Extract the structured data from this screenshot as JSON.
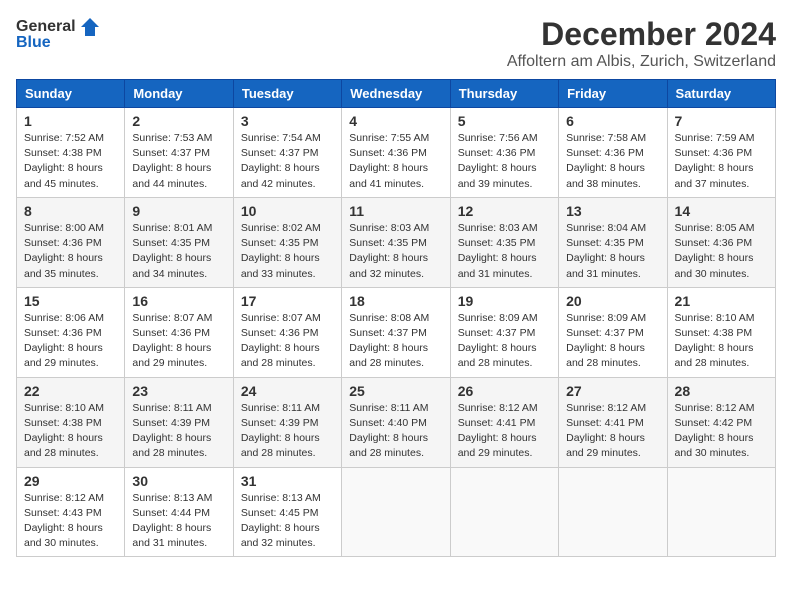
{
  "logo": {
    "line1": "General",
    "line2": "Blue"
  },
  "title": "December 2024",
  "location": "Affoltern am Albis, Zurich, Switzerland",
  "days_of_week": [
    "Sunday",
    "Monday",
    "Tuesday",
    "Wednesday",
    "Thursday",
    "Friday",
    "Saturday"
  ],
  "weeks": [
    [
      {
        "day": "1",
        "sunrise": "7:52 AM",
        "sunset": "4:38 PM",
        "daylight": "8 hours and 45 minutes."
      },
      {
        "day": "2",
        "sunrise": "7:53 AM",
        "sunset": "4:37 PM",
        "daylight": "8 hours and 44 minutes."
      },
      {
        "day": "3",
        "sunrise": "7:54 AM",
        "sunset": "4:37 PM",
        "daylight": "8 hours and 42 minutes."
      },
      {
        "day": "4",
        "sunrise": "7:55 AM",
        "sunset": "4:36 PM",
        "daylight": "8 hours and 41 minutes."
      },
      {
        "day": "5",
        "sunrise": "7:56 AM",
        "sunset": "4:36 PM",
        "daylight": "8 hours and 39 minutes."
      },
      {
        "day": "6",
        "sunrise": "7:58 AM",
        "sunset": "4:36 PM",
        "daylight": "8 hours and 38 minutes."
      },
      {
        "day": "7",
        "sunrise": "7:59 AM",
        "sunset": "4:36 PM",
        "daylight": "8 hours and 37 minutes."
      }
    ],
    [
      {
        "day": "8",
        "sunrise": "8:00 AM",
        "sunset": "4:36 PM",
        "daylight": "8 hours and 35 minutes."
      },
      {
        "day": "9",
        "sunrise": "8:01 AM",
        "sunset": "4:35 PM",
        "daylight": "8 hours and 34 minutes."
      },
      {
        "day": "10",
        "sunrise": "8:02 AM",
        "sunset": "4:35 PM",
        "daylight": "8 hours and 33 minutes."
      },
      {
        "day": "11",
        "sunrise": "8:03 AM",
        "sunset": "4:35 PM",
        "daylight": "8 hours and 32 minutes."
      },
      {
        "day": "12",
        "sunrise": "8:03 AM",
        "sunset": "4:35 PM",
        "daylight": "8 hours and 31 minutes."
      },
      {
        "day": "13",
        "sunrise": "8:04 AM",
        "sunset": "4:35 PM",
        "daylight": "8 hours and 31 minutes."
      },
      {
        "day": "14",
        "sunrise": "8:05 AM",
        "sunset": "4:36 PM",
        "daylight": "8 hours and 30 minutes."
      }
    ],
    [
      {
        "day": "15",
        "sunrise": "8:06 AM",
        "sunset": "4:36 PM",
        "daylight": "8 hours and 29 minutes."
      },
      {
        "day": "16",
        "sunrise": "8:07 AM",
        "sunset": "4:36 PM",
        "daylight": "8 hours and 29 minutes."
      },
      {
        "day": "17",
        "sunrise": "8:07 AM",
        "sunset": "4:36 PM",
        "daylight": "8 hours and 28 minutes."
      },
      {
        "day": "18",
        "sunrise": "8:08 AM",
        "sunset": "4:37 PM",
        "daylight": "8 hours and 28 minutes."
      },
      {
        "day": "19",
        "sunrise": "8:09 AM",
        "sunset": "4:37 PM",
        "daylight": "8 hours and 28 minutes."
      },
      {
        "day": "20",
        "sunrise": "8:09 AM",
        "sunset": "4:37 PM",
        "daylight": "8 hours and 28 minutes."
      },
      {
        "day": "21",
        "sunrise": "8:10 AM",
        "sunset": "4:38 PM",
        "daylight": "8 hours and 28 minutes."
      }
    ],
    [
      {
        "day": "22",
        "sunrise": "8:10 AM",
        "sunset": "4:38 PM",
        "daylight": "8 hours and 28 minutes."
      },
      {
        "day": "23",
        "sunrise": "8:11 AM",
        "sunset": "4:39 PM",
        "daylight": "8 hours and 28 minutes."
      },
      {
        "day": "24",
        "sunrise": "8:11 AM",
        "sunset": "4:39 PM",
        "daylight": "8 hours and 28 minutes."
      },
      {
        "day": "25",
        "sunrise": "8:11 AM",
        "sunset": "4:40 PM",
        "daylight": "8 hours and 28 minutes."
      },
      {
        "day": "26",
        "sunrise": "8:12 AM",
        "sunset": "4:41 PM",
        "daylight": "8 hours and 29 minutes."
      },
      {
        "day": "27",
        "sunrise": "8:12 AM",
        "sunset": "4:41 PM",
        "daylight": "8 hours and 29 minutes."
      },
      {
        "day": "28",
        "sunrise": "8:12 AM",
        "sunset": "4:42 PM",
        "daylight": "8 hours and 30 minutes."
      }
    ],
    [
      {
        "day": "29",
        "sunrise": "8:12 AM",
        "sunset": "4:43 PM",
        "daylight": "8 hours and 30 minutes."
      },
      {
        "day": "30",
        "sunrise": "8:13 AM",
        "sunset": "4:44 PM",
        "daylight": "8 hours and 31 minutes."
      },
      {
        "day": "31",
        "sunrise": "8:13 AM",
        "sunset": "4:45 PM",
        "daylight": "8 hours and 32 minutes."
      },
      null,
      null,
      null,
      null
    ]
  ],
  "labels": {
    "sunrise": "Sunrise:",
    "sunset": "Sunset:",
    "daylight": "Daylight:"
  },
  "colors": {
    "header_bg": "#1565c0",
    "header_text": "#ffffff",
    "accent": "#1565c0"
  }
}
